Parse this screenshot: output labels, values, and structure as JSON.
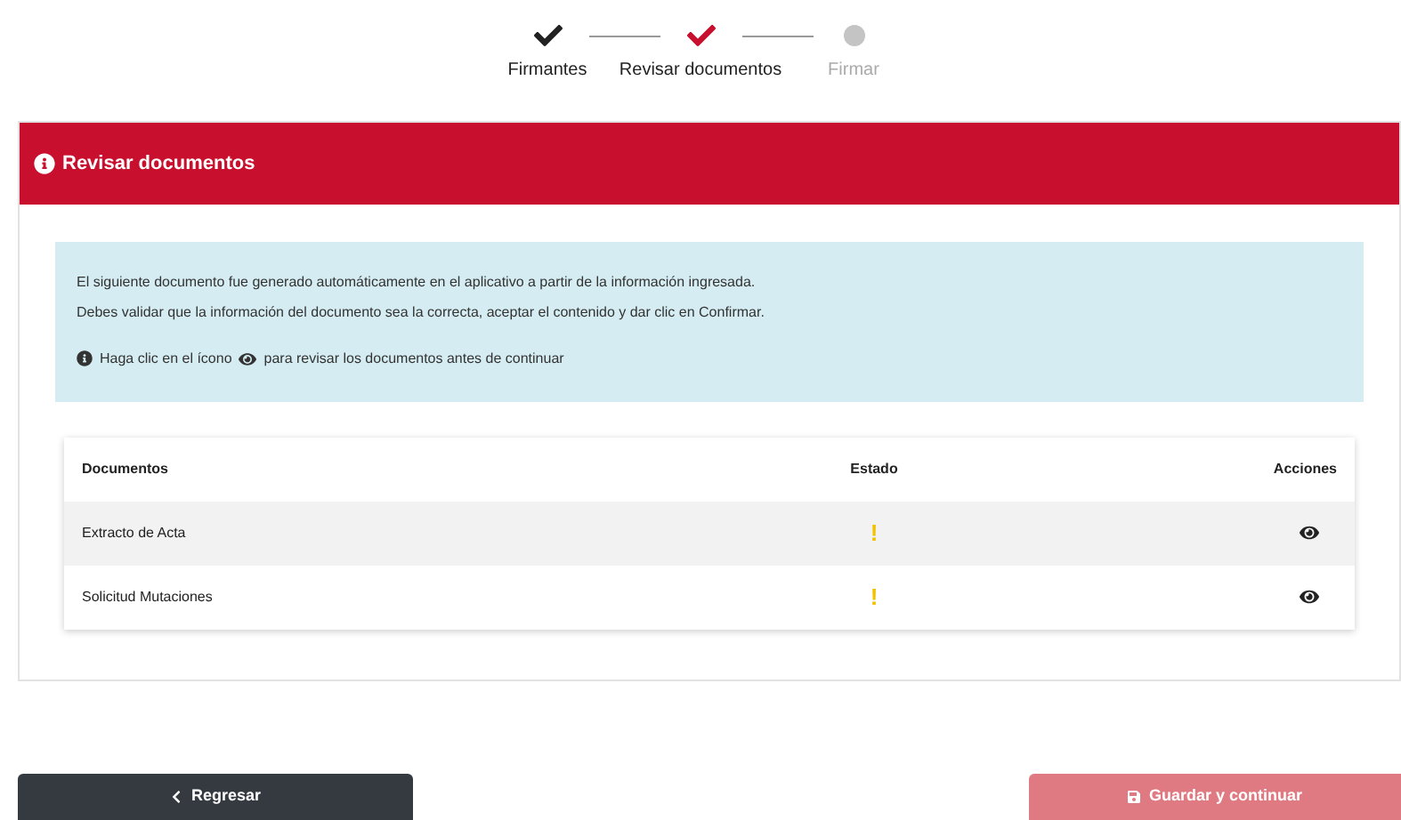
{
  "steps": [
    {
      "label": "Firmantes",
      "kind": "done"
    },
    {
      "label": "Revisar documentos",
      "kind": "current"
    },
    {
      "label": "Firmar",
      "kind": "pending"
    }
  ],
  "panel": {
    "title": "Revisar documentos"
  },
  "info": {
    "lines": [
      "El siguiente documento fue generado automáticamente en el aplicativo a partir de la información ingresada.",
      "Debes validar que la información del documento sea la correcta, aceptar el contenido y dar clic en Confirmar."
    ],
    "hint_before": "Haga clic en el ícono",
    "hint_after": "para revisar los documentos antes de continuar"
  },
  "table": {
    "columns": [
      "Documentos",
      "Estado",
      "Acciones"
    ],
    "rows": [
      {
        "name": "Extracto de Acta",
        "status": "!"
      },
      {
        "name": "Solicitud Mutaciones",
        "status": "!"
      }
    ]
  },
  "buttons": {
    "back": {
      "label": "Regresar"
    },
    "save": {
      "label": "Guardar y continuar",
      "disabled": true
    }
  }
}
